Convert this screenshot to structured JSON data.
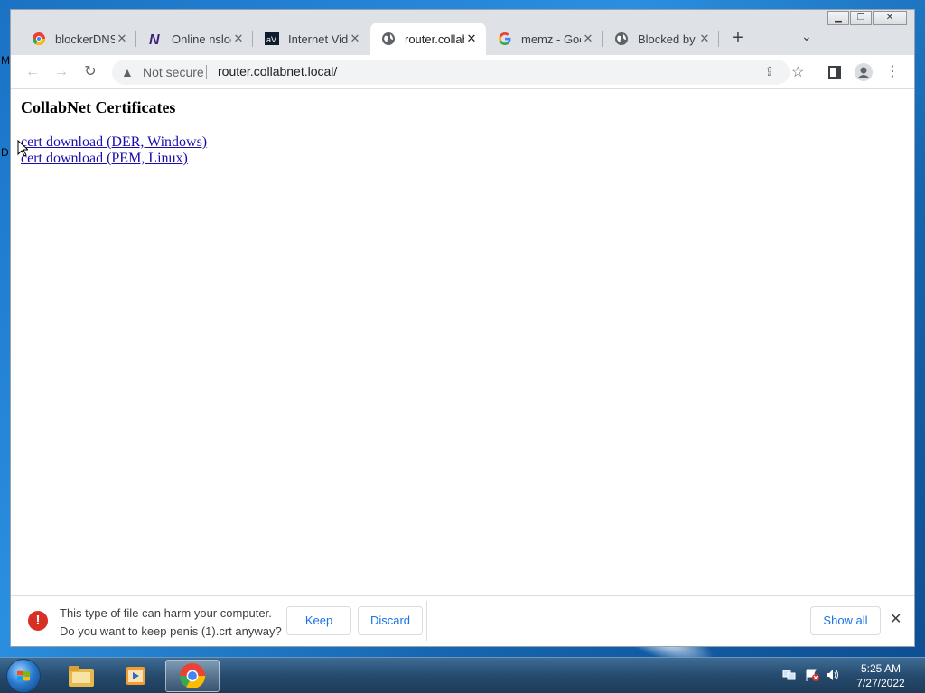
{
  "desktop": {
    "letter_m": "M",
    "letter_d": "D"
  },
  "browser": {
    "tabs": [
      {
        "title": "blockerDNS",
        "icon": "chrome-colorful-icon",
        "active": false
      },
      {
        "title": "Online nslookup",
        "icon": "n-logo-icon",
        "active": false
      },
      {
        "title": "Internet Video",
        "icon": "archive-icon",
        "active": false
      },
      {
        "title": "router.collabnet.local",
        "icon": "globe-icon",
        "active": true
      },
      {
        "title": "memz - Google",
        "icon": "google-icon",
        "active": false
      },
      {
        "title": "Blocked by",
        "icon": "globe-icon",
        "active": false
      }
    ],
    "new_tab_label": "+",
    "omnibox": {
      "security_label": "Not secure",
      "url": "router.collabnet.local/"
    }
  },
  "page": {
    "heading": "CollabNet Certificates",
    "links": [
      "cert download (DER, Windows)",
      "cert download (PEM, Linux)"
    ]
  },
  "download_bar": {
    "message_line1": "This type of file can harm your computer.",
    "message_line2": "Do you want to keep penis (1).crt anyway?",
    "keep_label": "Keep",
    "discard_label": "Discard",
    "show_all_label": "Show all"
  },
  "taskbar": {
    "time": "5:25 AM",
    "date": "7/27/2022"
  },
  "colors": {
    "link": "#1a0dab",
    "accent": "#1a73e8",
    "warning": "#d93025"
  }
}
